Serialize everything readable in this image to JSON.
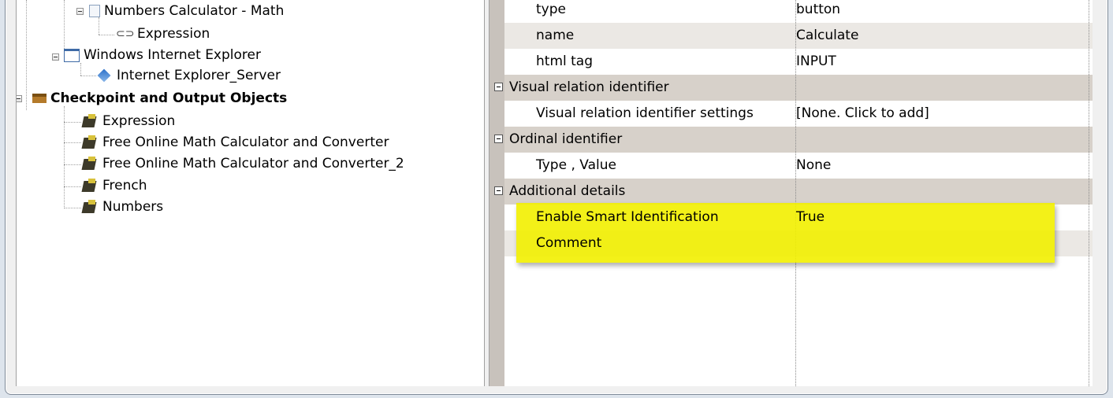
{
  "tree": {
    "items": [
      {
        "label": "Numbers Calculator - Math",
        "icon": "page-icon"
      },
      {
        "label": "Expression",
        "icon": "link-icon"
      },
      {
        "label": "Windows Internet Explorer",
        "icon": "window-icon"
      },
      {
        "label": "Internet Explorer_Server",
        "icon": "diamond-icon"
      },
      {
        "label": "Checkpoint and Output Objects",
        "icon": "chest-icon"
      },
      {
        "label": "Expression",
        "icon": "checkpoint-icon"
      },
      {
        "label": "Free Online Math Calculator and Converter",
        "icon": "checkpoint-icon"
      },
      {
        "label": "Free Online Math Calculator and Converter_2",
        "icon": "checkpoint-icon"
      },
      {
        "label": "French",
        "icon": "checkpoint-icon"
      },
      {
        "label": "Numbers",
        "icon": "checkpoint-icon"
      }
    ]
  },
  "properties": {
    "rows": [
      {
        "name": "type",
        "value": "button"
      },
      {
        "name": "name",
        "value": "Calculate"
      },
      {
        "name": "html tag",
        "value": "INPUT"
      },
      {
        "category": "Visual relation identifier"
      },
      {
        "name": "Visual relation identifier settings",
        "value": "[None. Click to add]"
      },
      {
        "category": "Ordinal identifier"
      },
      {
        "name": "Type , Value",
        "value": "None"
      },
      {
        "category": "Additional details"
      },
      {
        "name": "Enable Smart Identification",
        "value": "True"
      },
      {
        "name": "Comment",
        "value": ""
      }
    ]
  },
  "colors": {
    "highlight": "#f2f000",
    "category_bg": "#d7d1ca"
  }
}
